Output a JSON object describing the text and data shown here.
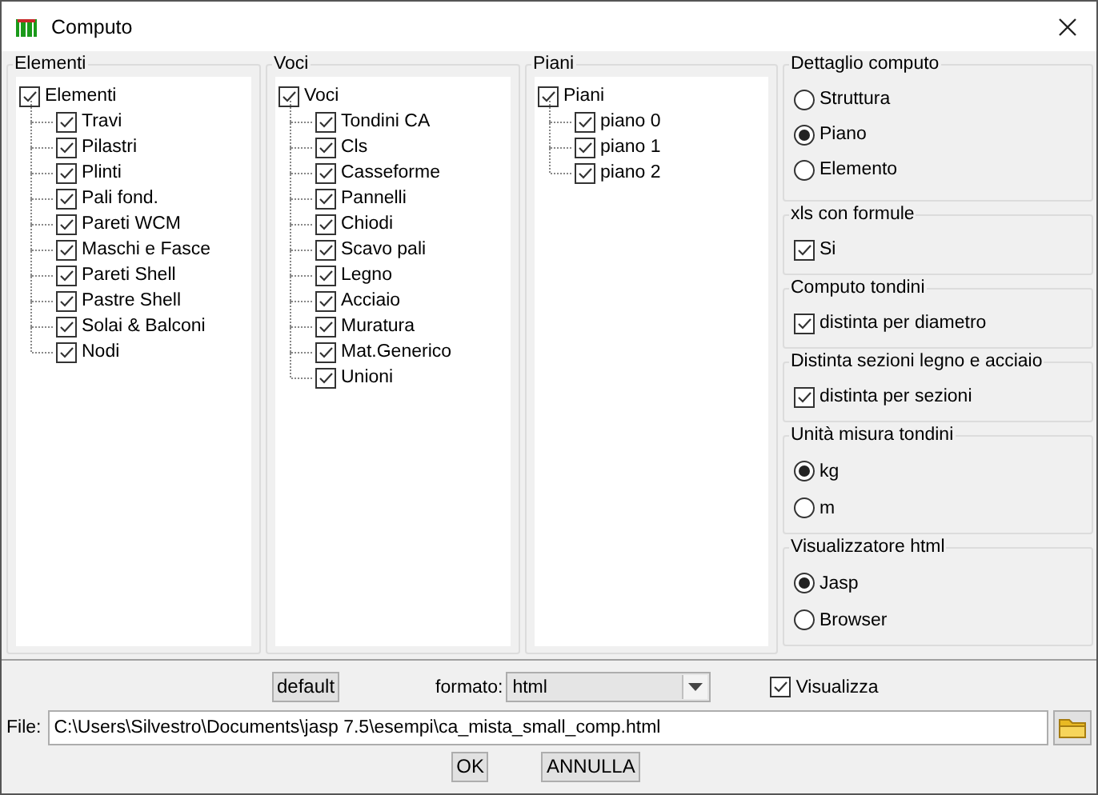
{
  "window": {
    "title": "Computo"
  },
  "trees": [
    {
      "title": "Elementi",
      "root": {
        "label": "Elementi",
        "checked": true,
        "children": [
          {
            "label": "Travi",
            "checked": true
          },
          {
            "label": "Pilastri",
            "checked": true
          },
          {
            "label": "Plinti",
            "checked": true
          },
          {
            "label": "Pali fond.",
            "checked": true
          },
          {
            "label": "Pareti WCM",
            "checked": true
          },
          {
            "label": "Maschi e Fasce",
            "checked": true
          },
          {
            "label": "Pareti Shell",
            "checked": true
          },
          {
            "label": "Pastre Shell",
            "checked": true
          },
          {
            "label": "Solai & Balconi",
            "checked": true
          },
          {
            "label": "Nodi",
            "checked": true
          }
        ]
      }
    },
    {
      "title": "Voci",
      "root": {
        "label": "Voci",
        "checked": true,
        "children": [
          {
            "label": "Tondini CA",
            "checked": true
          },
          {
            "label": "Cls",
            "checked": true
          },
          {
            "label": "Casseforme",
            "checked": true
          },
          {
            "label": "Pannelli",
            "checked": true
          },
          {
            "label": "Chiodi",
            "checked": true
          },
          {
            "label": "Scavo pali",
            "checked": true
          },
          {
            "label": "Legno",
            "checked": true
          },
          {
            "label": "Acciaio",
            "checked": true
          },
          {
            "label": "Muratura",
            "checked": true
          },
          {
            "label": "Mat.Generico",
            "checked": true
          },
          {
            "label": "Unioni",
            "checked": true
          }
        ]
      }
    },
    {
      "title": "Piani",
      "root": {
        "label": "Piani",
        "checked": true,
        "children": [
          {
            "label": "piano 0",
            "checked": true
          },
          {
            "label": "piano 1",
            "checked": true
          },
          {
            "label": "piano 2",
            "checked": true
          }
        ]
      }
    }
  ],
  "options": [
    {
      "title": "Dettaglio computo",
      "kind": "radio",
      "items": [
        {
          "label": "Struttura",
          "selected": false
        },
        {
          "label": "Piano",
          "selected": true
        },
        {
          "label": "Elemento",
          "selected": false
        }
      ]
    },
    {
      "title": "xls con formule",
      "kind": "checkbox",
      "items": [
        {
          "label": "Si",
          "checked": true
        }
      ]
    },
    {
      "title": "Computo tondini",
      "kind": "checkbox",
      "items": [
        {
          "label": "distinta per diametro",
          "checked": true
        }
      ]
    },
    {
      "title": "Distinta sezioni legno e acciaio",
      "kind": "checkbox",
      "items": [
        {
          "label": "distinta per sezioni",
          "checked": true
        }
      ]
    },
    {
      "title": "Unità misura tondini",
      "kind": "radio",
      "items": [
        {
          "label": "kg",
          "selected": true
        },
        {
          "label": "m",
          "selected": false
        }
      ]
    },
    {
      "title": "Visualizzatore html",
      "kind": "radio",
      "items": [
        {
          "label": "Jasp",
          "selected": true
        },
        {
          "label": "Browser",
          "selected": false
        }
      ]
    }
  ],
  "footer": {
    "default_button": "default",
    "format_label": "formato:",
    "format_value": "html",
    "view": {
      "label": "Visualizza",
      "checked": true
    },
    "file_label": "File:",
    "file_value": "C:\\Users\\Silvestro\\Documents\\jasp 7.5\\esempi\\ca_mista_small_comp.html",
    "ok_button": "OK",
    "cancel_button": "ANNULLA"
  }
}
